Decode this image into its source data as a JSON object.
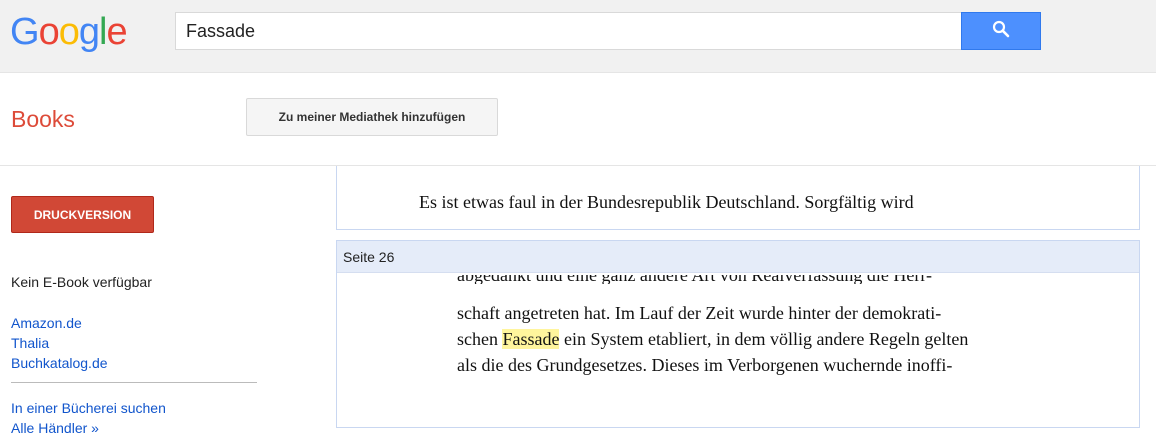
{
  "header": {
    "logo_letters": [
      "G",
      "o",
      "o",
      "g",
      "l",
      "e"
    ],
    "search_value": "Fassade",
    "search_icon": "search-icon",
    "search_button_color": "#4d90fe"
  },
  "subheader": {
    "section_title": "Books",
    "add_to_library_label": "Zu meiner Mediathek hinzufügen"
  },
  "sidebar": {
    "print_label": "DRUCKVERSION",
    "print_color": "#d14836",
    "no_ebook": "Kein E-Book verfügbar",
    "stores": [
      "Amazon.de",
      "Thalia",
      "Buchkatalog.de"
    ],
    "library_search": "In einer Bücherei suchen",
    "all_sellers": "Alle Händler »"
  },
  "viewer": {
    "page1_line": "Es ist etwas faul in der Bundesrepublik Deutschland. Sorgfältig wird",
    "page2_label": "Seite 26",
    "page2_cut_line": "abgedankt und eine ganz andere Art von Realverfassung die Herr-",
    "page2_lines": {
      "line1": "schaft angetreten hat. Im Lauf der Zeit wurde hinter der demokrati-",
      "line2_before": "schen ",
      "line2_highlight": "Fassade",
      "line2_after": " ein System etabliert, in dem völlig andere Regeln gelten",
      "line3": "als die des Grundgesetzes. Dieses im Verborgenen wuchernde inoffi-"
    },
    "highlight_color": "#fff59d"
  }
}
